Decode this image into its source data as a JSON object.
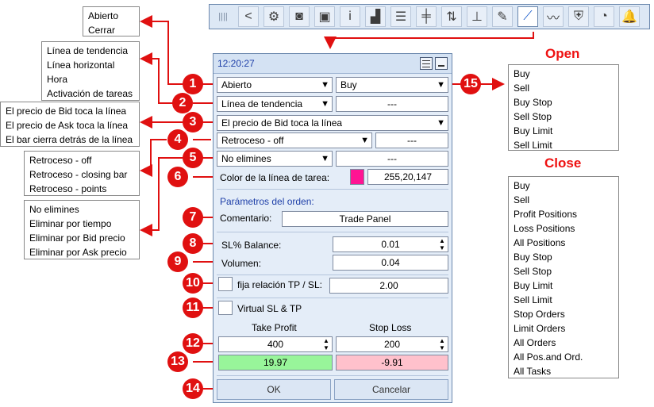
{
  "toolbar": {
    "buttons": [
      {
        "icon": "grip-icon",
        "glyph": "||||"
      },
      {
        "icon": "back-arrow-icon",
        "glyph": "<"
      },
      {
        "icon": "gear-icon",
        "glyph": "⚙"
      },
      {
        "icon": "camera-icon",
        "glyph": "◙"
      },
      {
        "icon": "briefcase-icon",
        "glyph": "▣"
      },
      {
        "icon": "info-icon",
        "glyph": "i"
      },
      {
        "icon": "signal-bars-icon",
        "glyph": "▟"
      },
      {
        "icon": "list-icon",
        "glyph": "☰"
      },
      {
        "icon": "candlestick-icon",
        "glyph": "╪"
      },
      {
        "icon": "up-down-arrows-icon",
        "glyph": "⇅"
      },
      {
        "icon": "price-level-icon",
        "glyph": "⊥"
      },
      {
        "icon": "edit-chart-icon",
        "glyph": "✎"
      },
      {
        "icon": "trendline-tasks-icon",
        "glyph": "⟋"
      },
      {
        "icon": "trend-chart-icon",
        "glyph": "〰"
      },
      {
        "icon": "shield-icon",
        "glyph": "⛨"
      },
      {
        "icon": "pie-chart-icon",
        "glyph": "◔"
      },
      {
        "icon": "bell-icon",
        "glyph": "🔔"
      }
    ],
    "active_index": 12
  },
  "panel": {
    "time": "12:20:27",
    "mode": "Abierto",
    "action": "Buy",
    "line_type": "Línea de tendencia",
    "line_name": "---",
    "trigger": "El precio de Bid toca la línea",
    "pullback": "Retroceso - off",
    "pullback_value": "---",
    "delete_mode": "No elimines",
    "delete_value": "---",
    "color_label": "Color de la línea de tarea:",
    "color_value": "255,20,147",
    "color_swatch": "#ff1493",
    "order_params_label": "Parámetros del orden:",
    "comment_label": "Comentario:",
    "comment_value": "Trade Panel",
    "sl_balance_label": "SL% Balance:",
    "sl_balance_value": "0.01",
    "volume_label": "Volumen:",
    "volume_value": "0.04",
    "tp_sl_ratio_label": "fija relación TP / SL:",
    "tp_sl_ratio_value": "2.00",
    "virtual_label": "Virtual SL & TP",
    "tp_label": "Take Profit",
    "sl_label": "Stop Loss",
    "tp_value": "400",
    "sl_value": "200",
    "tp_money": "19.97",
    "sl_money": "-9.91",
    "ok_label": "OK",
    "cancel_label": "Cancelar"
  },
  "callouts": {
    "mode_options": [
      "Abierto",
      "Cerrar"
    ],
    "line_options": [
      "Línea de tendencia",
      "Línea horizontal",
      "Hora",
      "Activación de tareas"
    ],
    "trigger_options": [
      "El precio de Bid toca la línea",
      "El precio de Ask toca la línea",
      "El bar cierra detrás de la línea"
    ],
    "pullback_options": [
      "Retroceso - off",
      "Retroceso - closing bar",
      "Retroceso - points"
    ],
    "delete_options": [
      "No elimines",
      "Eliminar por tiempo",
      "Eliminar por Bid precio",
      "Eliminar por Ask precio"
    ],
    "open_heading": "Open",
    "open_options": [
      "Buy",
      "Sell",
      "Buy Stop",
      "Sell Stop",
      "Buy Limit",
      "Sell Limit"
    ],
    "close_heading": "Close",
    "close_options": [
      "Buy",
      "Sell",
      "Profit Positions",
      "Loss Positions",
      "All Positions",
      "Buy Stop",
      "Sell Stop",
      "Buy Limit",
      "Sell Limit",
      "Stop Orders",
      "Limit Orders",
      "All Orders",
      "All Pos.and Ord.",
      "All Tasks"
    ]
  },
  "badges": [
    "1",
    "2",
    "3",
    "4",
    "5",
    "6",
    "7",
    "8",
    "9",
    "10",
    "11",
    "12",
    "13",
    "14",
    "15"
  ],
  "colors": {
    "badge": "#e01010",
    "tp_bg": "#98f59a",
    "sl_bg": "#ffc1cc",
    "accent": "#1e3fa8"
  }
}
